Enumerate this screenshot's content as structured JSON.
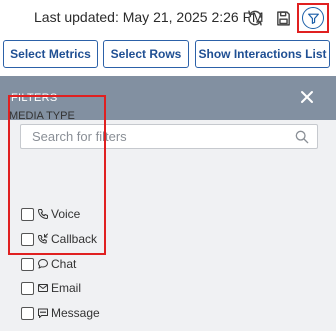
{
  "header": {
    "last_updated": "Last updated: May 21, 2025 2:26 PM",
    "icons": [
      "refresh-icon",
      "save-icon",
      "filter-icon"
    ]
  },
  "toolbar": {
    "select_metrics": "Select Metrics",
    "select_rows": "Select Rows",
    "show_interactions": "Show Interactions List"
  },
  "filters_panel": {
    "title": "FILTERS",
    "search_placeholder": "Search for filters",
    "media_type": {
      "heading": "MEDIA TYPE",
      "options": [
        {
          "label": "Voice",
          "icon": "phone-icon",
          "checked": false
        },
        {
          "label": "Callback",
          "icon": "callback-icon",
          "checked": false
        },
        {
          "label": "Chat",
          "icon": "chat-icon",
          "checked": false
        },
        {
          "label": "Email",
          "icon": "email-icon",
          "checked": false
        },
        {
          "label": "Message",
          "icon": "message-icon",
          "checked": false
        }
      ]
    }
  },
  "colors": {
    "button_text": "#1f4f93",
    "panel_header": "#8290a1",
    "panel_body": "#f0f1f3",
    "highlight": "#e02020"
  }
}
